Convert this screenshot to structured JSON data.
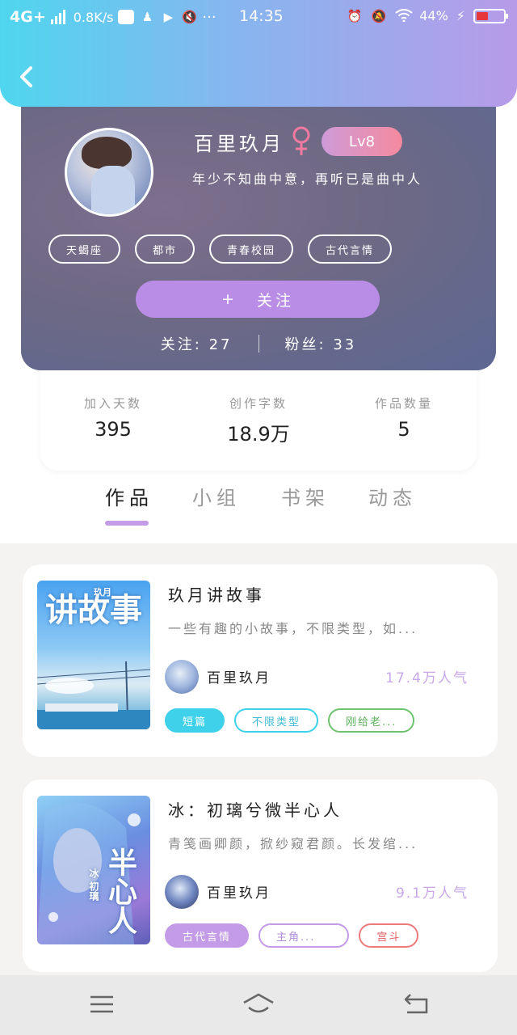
{
  "status_bar": {
    "network": "4G+",
    "speed": "0.8K/s",
    "more": "···",
    "time": "14:35",
    "battery_percent": "44%",
    "battery_level": 0.44,
    "battery_color": "#e5383b"
  },
  "header": {
    "back_icon": "chevron-left-icon"
  },
  "profile": {
    "name": "百里玖月",
    "gender_icon": "female-icon",
    "level": "Lv8",
    "bio": "年少不知曲中意，再听已是曲中人",
    "tags": [
      "天蝎座",
      "都市",
      "青春校园",
      "古代言情"
    ],
    "follow_plus": "+",
    "follow_label": "关注",
    "following_label": "关注:",
    "following_count": "27",
    "fans_label": "粉丝:",
    "fans_count": "33"
  },
  "stats": {
    "days_label": "加入天数",
    "days_value": "395",
    "words_label": "创作字数",
    "words_value": "18.9万",
    "works_label": "作品数量",
    "works_value": "5"
  },
  "tabs": [
    "作品",
    "小组",
    "书架",
    "动态"
  ],
  "works": [
    {
      "cover_title": "讲故事",
      "cover_small": "玖月",
      "title": "玖月讲故事",
      "description": "一些有趣的小故事，不限类型，如...",
      "author": "百里玖月",
      "popularity": "17.4万人气",
      "tags": [
        "短篇",
        "不限类型",
        "刚给老..."
      ]
    },
    {
      "cover_title": "半心人",
      "cover_small": "冰 初璃",
      "title": "冰：初璃兮微半心人",
      "description": "青笺画卿颜，掀纱窥君颜。长发绾...",
      "author": "百里玖月",
      "popularity": "9.1万人气",
      "tags": [
        "古代言情",
        "主角...",
        "宫斗"
      ]
    }
  ],
  "colors": {
    "header_gradient_start": "#4fd6ef",
    "header_gradient_end": "#b79be8",
    "accent_purple": "#c39be6",
    "accent_cyan": "#3fd1ea"
  }
}
